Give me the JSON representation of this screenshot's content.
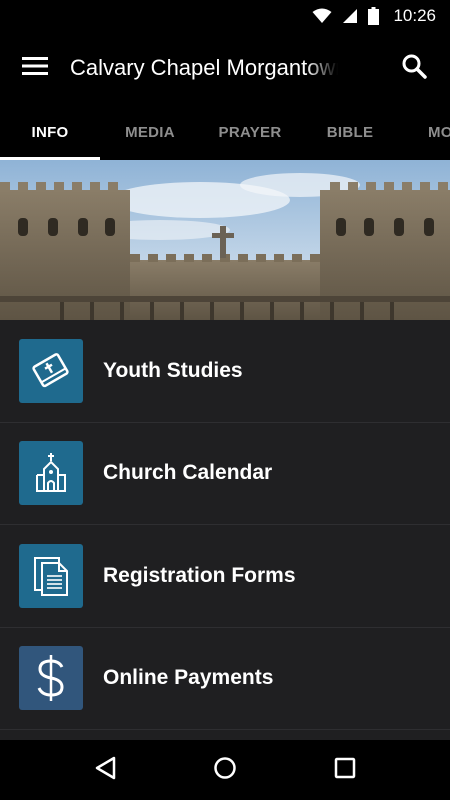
{
  "status_bar": {
    "time": "10:26"
  },
  "app_bar": {
    "title": "Calvary Chapel Morgantown"
  },
  "tabs": [
    {
      "label": "INFO",
      "active": true
    },
    {
      "label": "MEDIA",
      "active": false
    },
    {
      "label": "PRAYER",
      "active": false
    },
    {
      "label": "BIBLE",
      "active": false
    },
    {
      "label": "MORE",
      "active": false
    }
  ],
  "list_items": [
    {
      "label": "Youth Studies",
      "icon": "bible-icon"
    },
    {
      "label": "Church Calendar",
      "icon": "church-icon"
    },
    {
      "label": "Registration Forms",
      "icon": "document-icon"
    },
    {
      "label": "Online Payments",
      "icon": "dollar-icon"
    }
  ],
  "colors": {
    "icon_tile": "#1f6a8e",
    "icon_tile_alt": "#31567c",
    "list_bg": "#1f1f21",
    "bar_bg": "#000000"
  }
}
